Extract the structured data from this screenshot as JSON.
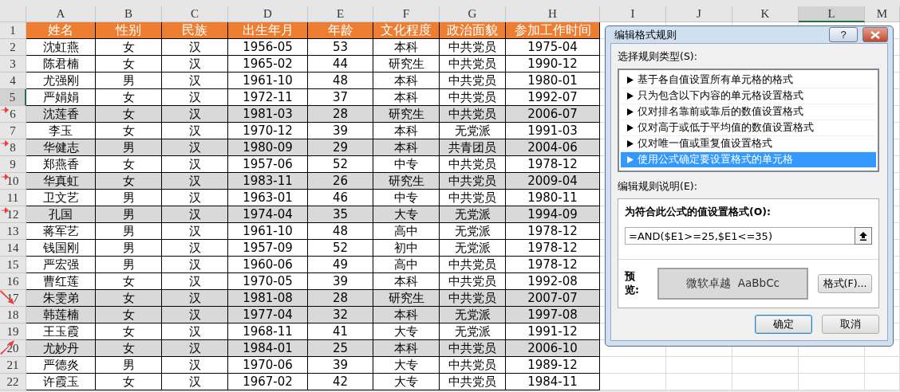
{
  "sheet": {
    "columns": [
      {
        "label": "A",
        "selected": false
      },
      {
        "label": "B",
        "selected": false
      },
      {
        "label": "C",
        "selected": false
      },
      {
        "label": "D",
        "selected": false
      },
      {
        "label": "E",
        "selected": false
      },
      {
        "label": "F",
        "selected": false
      },
      {
        "label": "G",
        "selected": false
      },
      {
        "label": "H",
        "selected": false
      },
      {
        "label": "I",
        "selected": false
      },
      {
        "label": "J",
        "selected": false
      },
      {
        "label": "K",
        "selected": false
      },
      {
        "label": "L",
        "selected": true
      },
      {
        "label": "M",
        "selected": false
      }
    ],
    "rows": [
      {
        "number": "1",
        "selected": false,
        "kind": "header",
        "cells": [
          "姓名",
          "性别",
          "民族",
          "出生年月",
          "年龄",
          "文化程度",
          "政治面貌",
          "参加工作时间"
        ]
      },
      {
        "number": "2",
        "selected": false,
        "kind": "data",
        "highlighted": false,
        "cells": [
          "沈虹燕",
          "女",
          "汉",
          "1956-05",
          "53",
          "本科",
          "中共党员",
          "1975-04"
        ]
      },
      {
        "number": "3",
        "selected": false,
        "kind": "data",
        "highlighted": false,
        "cells": [
          "陈君楠",
          "女",
          "汉",
          "1965-02",
          "44",
          "研究生",
          "中共党员",
          "1990-12"
        ]
      },
      {
        "number": "4",
        "selected": false,
        "kind": "data",
        "highlighted": false,
        "cells": [
          "尤强刚",
          "男",
          "汉",
          "1961-10",
          "48",
          "本科",
          "中共党员",
          "1980-01"
        ]
      },
      {
        "number": "5",
        "selected": true,
        "kind": "data",
        "highlighted": false,
        "cells": [
          "严娟娟",
          "女",
          "汉",
          "1972-11",
          "37",
          "本科",
          "中共党员",
          "1992-07"
        ]
      },
      {
        "number": "6",
        "selected": false,
        "kind": "data",
        "highlighted": true,
        "marker": {
          "kind": "right"
        },
        "cells": [
          "沈莲香",
          "女",
          "汉",
          "1981-03",
          "28",
          "研究生",
          "中共党员",
          "2006-07"
        ]
      },
      {
        "number": "7",
        "selected": false,
        "kind": "data",
        "highlighted": false,
        "cells": [
          "李玉",
          "女",
          "汉",
          "1970-12",
          "39",
          "本科",
          "无党派",
          "1991-03"
        ]
      },
      {
        "number": "8",
        "selected": false,
        "kind": "data",
        "highlighted": true,
        "marker": {
          "kind": "right"
        },
        "cells": [
          "华健志",
          "男",
          "汉",
          "1980-09",
          "29",
          "本科",
          "共青团员",
          "2004-06"
        ]
      },
      {
        "number": "9",
        "selected": false,
        "kind": "data",
        "highlighted": false,
        "cells": [
          "郑燕香",
          "女",
          "汉",
          "1957-06",
          "52",
          "中专",
          "中共党员",
          "1978-12"
        ]
      },
      {
        "number": "10",
        "selected": false,
        "kind": "data",
        "highlighted": true,
        "marker": {
          "kind": "right"
        },
        "cells": [
          "华真虹",
          "女",
          "汉",
          "1983-11",
          "26",
          "研究生",
          "中共党员",
          "2009-04"
        ]
      },
      {
        "number": "11",
        "selected": false,
        "kind": "data",
        "highlighted": false,
        "cells": [
          "卫文艺",
          "男",
          "汉",
          "1963-01",
          "46",
          "中专",
          "中共党员",
          "1980-11"
        ]
      },
      {
        "number": "12",
        "selected": false,
        "kind": "data",
        "highlighted": true,
        "marker": {
          "kind": "right"
        },
        "cells": [
          "孔国",
          "男",
          "汉",
          "1974-04",
          "35",
          "大专",
          "无党派",
          "1994-09"
        ]
      },
      {
        "number": "13",
        "selected": false,
        "kind": "data",
        "highlighted": false,
        "cells": [
          "蒋军艺",
          "男",
          "汉",
          "1961-10",
          "48",
          "高中",
          "无党派",
          "1978-12"
        ]
      },
      {
        "number": "14",
        "selected": false,
        "kind": "data",
        "highlighted": false,
        "cells": [
          "钱国刚",
          "男",
          "汉",
          "1957-09",
          "52",
          "初中",
          "无党派",
          "1978-12"
        ]
      },
      {
        "number": "15",
        "selected": false,
        "kind": "data",
        "highlighted": false,
        "cells": [
          "严宏强",
          "男",
          "汉",
          "1960-06",
          "49",
          "高中",
          "中共党员",
          "1978-12"
        ]
      },
      {
        "number": "16",
        "selected": false,
        "kind": "data",
        "highlighted": false,
        "cells": [
          "曹红莲",
          "女",
          "汉",
          "1970-05",
          "39",
          "本科",
          "中共党员",
          "1992-08"
        ]
      },
      {
        "number": "17",
        "selected": false,
        "kind": "data",
        "highlighted": true,
        "marker": {
          "kind": "down"
        },
        "cells": [
          "朱雯弟",
          "女",
          "汉",
          "1981-08",
          "28",
          "研究生",
          "中共党员",
          "2007-07"
        ]
      },
      {
        "number": "18",
        "selected": false,
        "kind": "data",
        "highlighted": true,
        "cells": [
          "韩莲楠",
          "女",
          "汉",
          "1977-04",
          "32",
          "本科",
          "无党派",
          "1997-08"
        ]
      },
      {
        "number": "19",
        "selected": false,
        "kind": "data",
        "highlighted": false,
        "cells": [
          "王玉霞",
          "女",
          "汉",
          "1968-11",
          "41",
          "大专",
          "无党派",
          "1991-12"
        ]
      },
      {
        "number": "20",
        "selected": false,
        "kind": "data",
        "highlighted": true,
        "marker": {
          "kind": "up"
        },
        "cells": [
          "尤妙丹",
          "女",
          "汉",
          "1984-01",
          "25",
          "本科",
          "中共党员",
          "2006-10"
        ]
      },
      {
        "number": "21",
        "selected": false,
        "kind": "data",
        "highlighted": false,
        "cells": [
          "严德炎",
          "男",
          "汉",
          "1970-06",
          "39",
          "大专",
          "中共党员",
          "1989-12"
        ]
      },
      {
        "number": "22",
        "selected": false,
        "kind": "data",
        "highlighted": false,
        "cells": [
          "许霞玉",
          "女",
          "汉",
          "1967-02",
          "42",
          "大专",
          "中共党员",
          "1984-11"
        ]
      }
    ]
  },
  "dialog": {
    "title": "编辑格式规则",
    "help_button": "?",
    "rule_type_label": "选择规则类型(S):",
    "rule_types": [
      {
        "label": "基于各自值设置所有单元格的格式",
        "selected": false
      },
      {
        "label": "只为包含以下内容的单元格设置格式",
        "selected": false
      },
      {
        "label": "仅对排名靠前或靠后的数值设置格式",
        "selected": false
      },
      {
        "label": "仅对高于或低于平均值的数值设置格式",
        "selected": false
      },
      {
        "label": "仅对唯一值或重复值设置格式",
        "selected": false
      },
      {
        "label": "使用公式确定要设置格式的单元格",
        "selected": true
      }
    ],
    "description_label": "编辑规则说明(E):",
    "formula_label": "为符合此公式的值设置格式(O):",
    "formula": "=AND($E1>=25,$E1<=35)",
    "preview_label": "预览:",
    "preview_text": "微软卓越  AaBbCc",
    "format_button": "格式(F)...",
    "ok_button": "确定",
    "cancel_button": "取消"
  }
}
